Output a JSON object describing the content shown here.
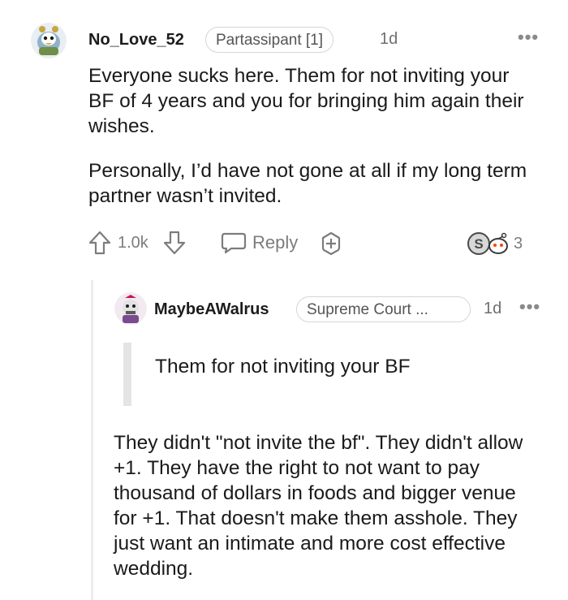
{
  "comment": {
    "username": "No_Love_52",
    "flair": "Partassipant [1]",
    "time": "1d",
    "paragraphs": [
      "Everyone sucks here. Them for not inviting your BF of 4 years and you for bringing him again their wishes.",
      "Personally, I’d have not gone at all if my long term partner wasn’t invited."
    ],
    "votes": "1.0k",
    "reply_label": "Reply",
    "awards_count": "3",
    "more": "•••"
  },
  "reply": {
    "username": "MaybeAWalrus",
    "flair": "Supreme Court ...",
    "time": "1d",
    "more": "•••",
    "quote": "Them for not inviting your BF",
    "body": "They didn't \"not invite the bf\". They didn't allow +1. They have the right to not want to pay thousand of dollars in foods and bigger venue for +1. That doesn't make them asshole. They just want an intimate and more cost effective wedding."
  }
}
